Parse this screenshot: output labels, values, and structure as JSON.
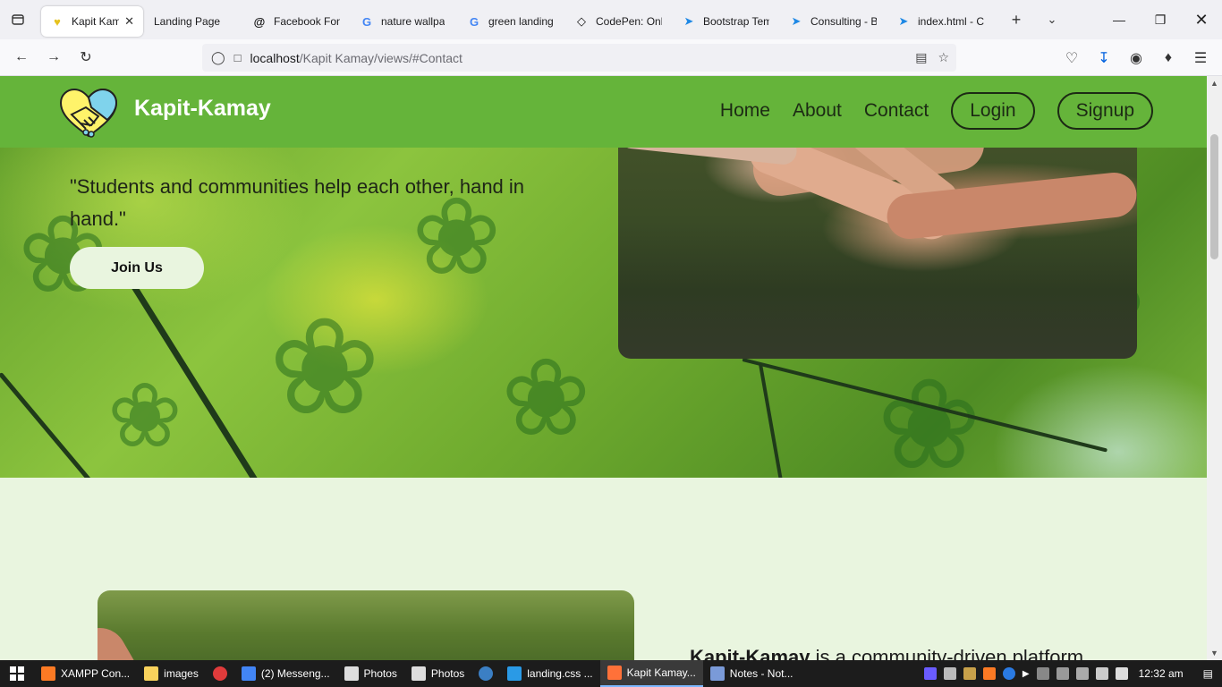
{
  "browser": {
    "tabs": [
      {
        "title": "Kapit Kama",
        "active": true,
        "favicon": "heart-hands-icon"
      },
      {
        "title": "Landing Page",
        "active": false,
        "favicon": ""
      },
      {
        "title": "Facebook Fon",
        "active": false,
        "favicon": "threads-icon"
      },
      {
        "title": "nature wallpa",
        "active": false,
        "favicon": "google-icon"
      },
      {
        "title": "green landing",
        "active": false,
        "favicon": "google-icon"
      },
      {
        "title": "CodePen: Onli",
        "active": false,
        "favicon": "codepen-icon"
      },
      {
        "title": "Bootstrap Tem",
        "active": false,
        "favicon": "bootstrapmade-icon"
      },
      {
        "title": "Consulting - B",
        "active": false,
        "favicon": "bootstrapmade-icon"
      },
      {
        "title": "index.html - C",
        "active": false,
        "favicon": "bootstrapmade-icon"
      }
    ],
    "url_host": "localhost",
    "url_path": "/Kapit Kamay/views/#Contact"
  },
  "site": {
    "brand": "Kapit-Kamay",
    "nav": {
      "home": "Home",
      "about": "About",
      "contact": "Contact",
      "login": "Login",
      "signup": "Signup"
    },
    "hero": {
      "quote": "\"Students and communities help each other, hand in hand.\"",
      "join_label": "Join Us"
    },
    "about": {
      "intro_bold": "Kapit-Kamay",
      "intro_rest": " is a community-driven platform"
    },
    "colors": {
      "header": "#65b43a",
      "section_bg": "#e9f5df",
      "button_bg": "#e9f5df"
    }
  },
  "taskbar": {
    "items": [
      {
        "label": "XAMPP Con...",
        "color": "#fb7a24",
        "active": false
      },
      {
        "label": "images",
        "color": "#f8d25c",
        "active": false
      },
      {
        "label": "",
        "color": "#e03b3b",
        "active": false
      },
      {
        "label": "(2) Messeng...",
        "color": "#4285f4",
        "active": false
      },
      {
        "label": "Photos",
        "color": "#dddddd",
        "active": false
      },
      {
        "label": "Photos",
        "color": "#dddddd",
        "active": false
      },
      {
        "label": "",
        "color": "#3b7fc4",
        "active": false
      },
      {
        "label": "landing.css ...",
        "color": "#2a9ae6",
        "active": false
      },
      {
        "label": "Kapit Kamay...",
        "color": "#ff7139",
        "active": true
      },
      {
        "label": "Notes - Not...",
        "color": "#7a9ad8",
        "active": false
      }
    ],
    "clock": "12:32 am"
  }
}
